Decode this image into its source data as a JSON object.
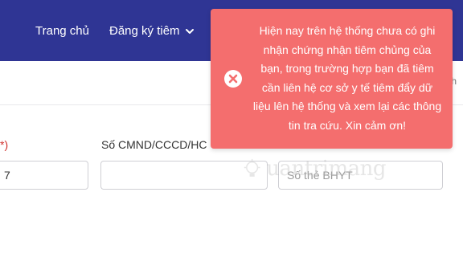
{
  "nav": {
    "home_label": "Trang chủ",
    "register_label": "Đăng ký tiêm"
  },
  "subbar": {
    "edge_text": "h"
  },
  "form": {
    "label_required_suffix": "*)",
    "id_label": "Số CMND/CCCD/HC",
    "left_value": "7",
    "id_value": "",
    "insurance_placeholder": "Số thẻ BHYT"
  },
  "toast": {
    "icon": "close-circle-icon",
    "message": "Hiện nay trên hệ thống chưa có ghi nhận chứng nhận tiêm chủng của bạn, trong trường hợp bạn đã tiêm cần liên hệ cơ sở y tế tiêm đẩy dữ liệu lên hệ thống và xem lại các thông tin tra cứu. Xin cảm ơn!",
    "background": "#f46e6e"
  },
  "watermark": {
    "text": "uantrimang"
  },
  "colors": {
    "navbar": "#2f3594",
    "required": "#d0312d"
  }
}
